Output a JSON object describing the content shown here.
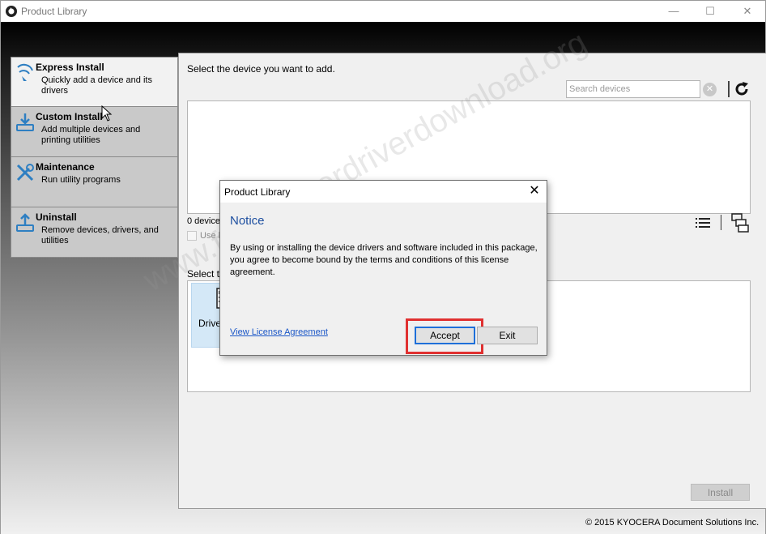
{
  "window": {
    "title": "Product Library",
    "controls": {
      "minimize": "—",
      "maximize": "☐",
      "close": "✕"
    }
  },
  "nav": {
    "items": [
      {
        "title": "Express Install",
        "desc": "Quickly add a device and its drivers",
        "icon": "express-install-icon",
        "selected": true
      },
      {
        "title": "Custom Install",
        "desc": "Add multiple devices and printing utilities",
        "icon": "custom-install-icon",
        "selected": false
      },
      {
        "title": "Maintenance",
        "desc": "Run utility programs",
        "icon": "maintenance-icon",
        "selected": false
      },
      {
        "title": "Uninstall",
        "desc": "Remove devices, drivers, and utilities",
        "icon": "uninstall-icon",
        "selected": false
      }
    ]
  },
  "main": {
    "select_device_label": "Select the device you want to add.",
    "search": {
      "placeholder": "Search devices",
      "value": ""
    },
    "device_count": "0 device",
    "use_label": "Use h",
    "select_software_label": "Select th",
    "software_tile_label": "Driver",
    "install_label": "Install"
  },
  "footer": {
    "copyright": "© 2015 KYOCERA Document Solutions Inc."
  },
  "watermark": {
    "text": "www.freeprinterdriverdownload.org"
  },
  "dialog": {
    "title": "Product Library",
    "close": "✕",
    "heading": "Notice",
    "body": "By using or installing the device drivers and software included in this package, you agree to become bound by the terms and conditions of this license agreement.",
    "link": "View License Agreement",
    "accept_label": "Accept",
    "exit_label": "Exit"
  },
  "colors": {
    "heading_blue": "#1d4fa0",
    "link_blue": "#1a56c7",
    "highlight_red": "#e03030",
    "tile_selected": "#d4e8f7",
    "focus_border": "#1e6fd9"
  }
}
